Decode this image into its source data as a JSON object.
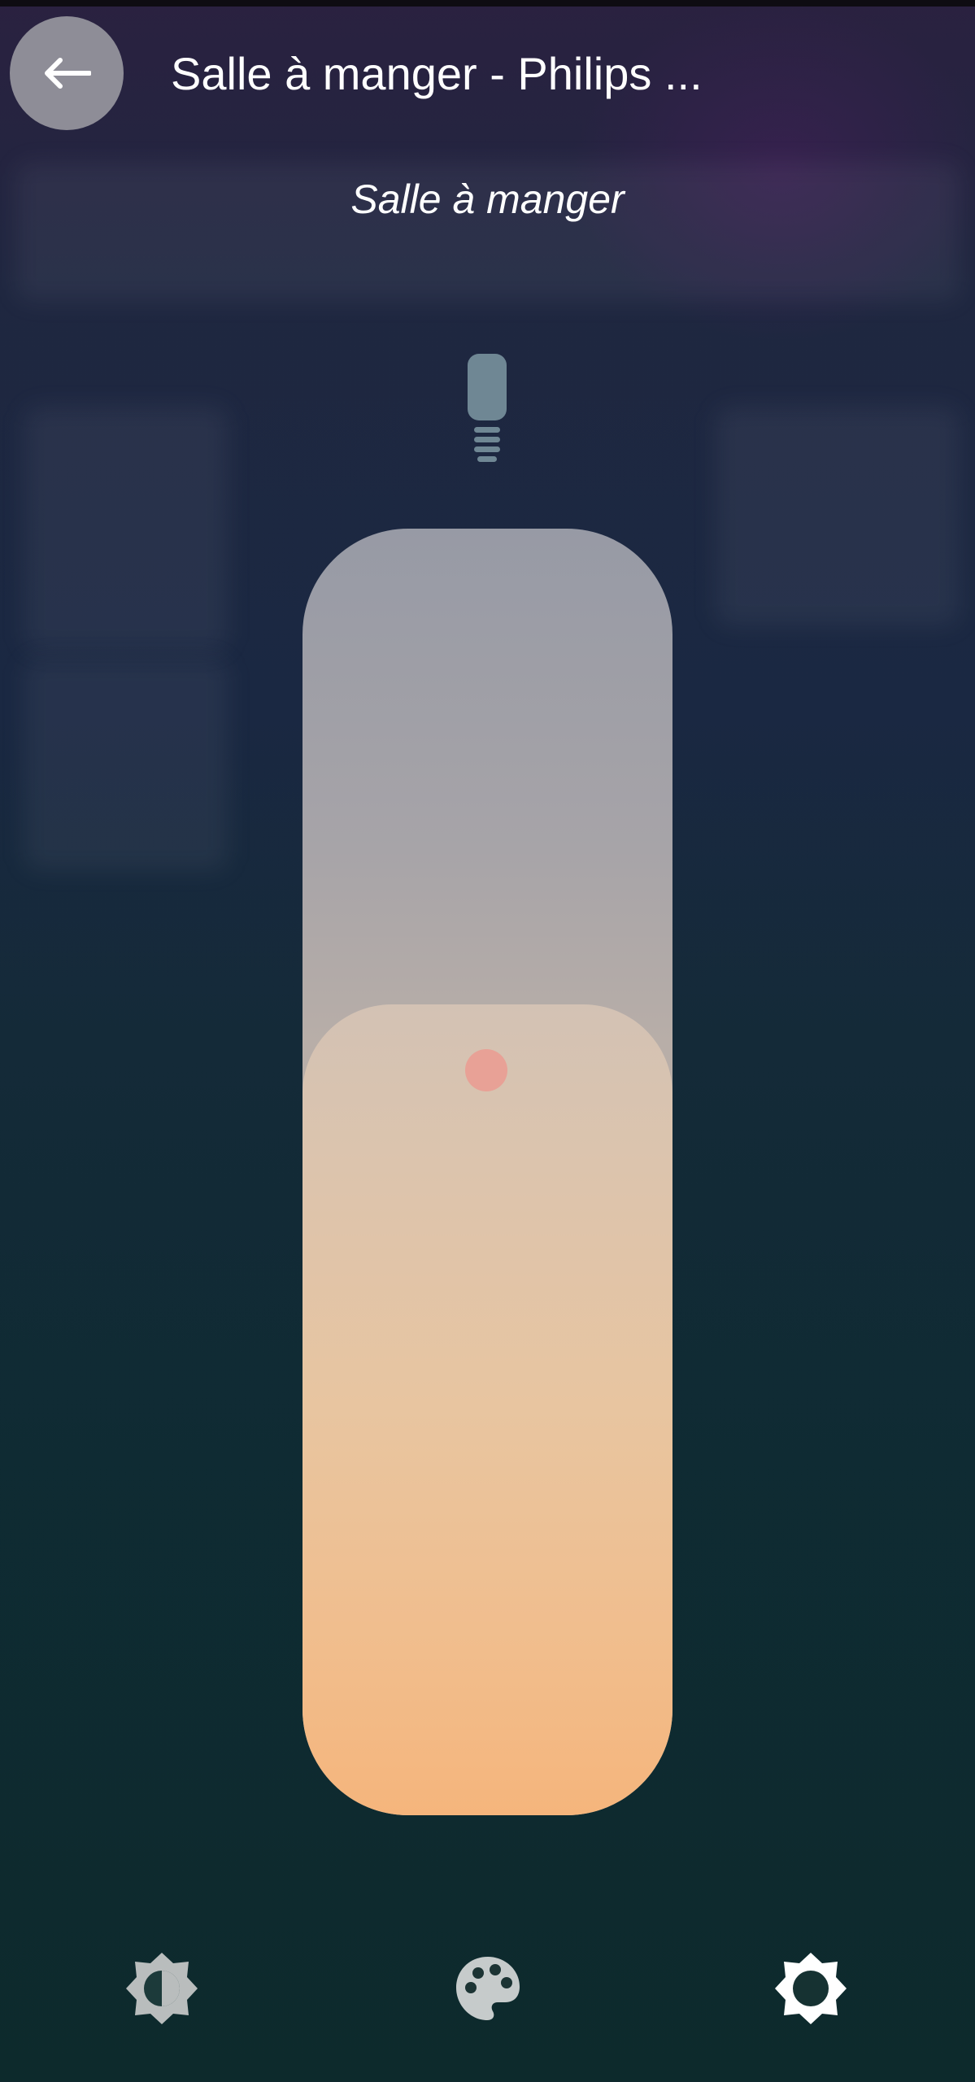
{
  "header": {
    "back_icon": "arrow-left-icon",
    "title": "Salle à manger - Philips ..."
  },
  "light": {
    "room_name": "Salle à manger",
    "bulb_icon": "light-bulb-icon",
    "brightness_fraction": 0.63,
    "colors": {
      "track_top": "#979aa5",
      "fill_bottom": "#f5b57c",
      "handle": "#e8a196"
    }
  },
  "toolbar": {
    "items": [
      {
        "name": "brightness",
        "icon": "brightness-icon"
      },
      {
        "name": "palette",
        "icon": "palette-icon"
      },
      {
        "name": "settings",
        "icon": "gear-icon"
      }
    ]
  }
}
